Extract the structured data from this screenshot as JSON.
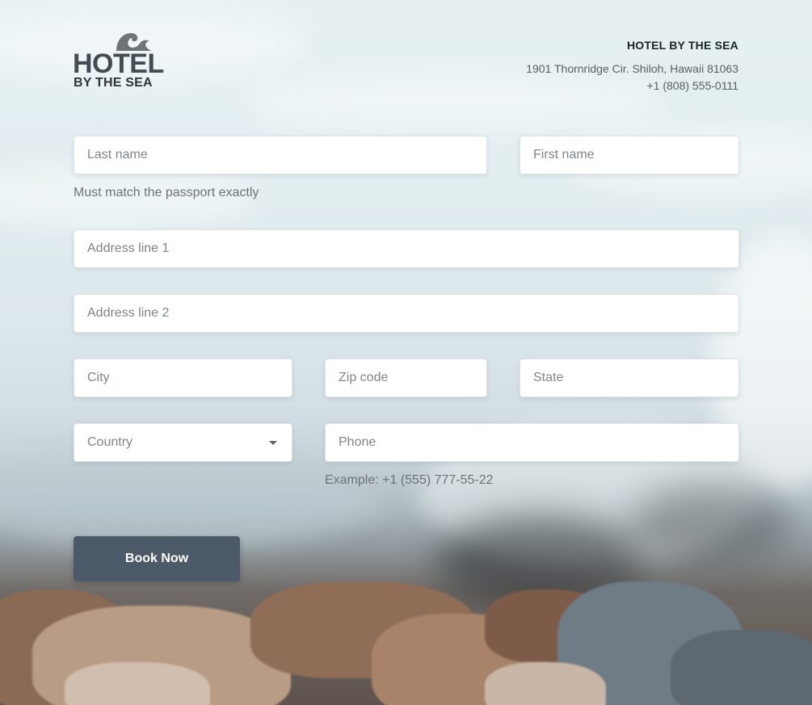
{
  "logo": {
    "line1": "HOTEL",
    "line2": "BY THE SEA"
  },
  "contact": {
    "hotel_name": "HOTEL BY THE SEA",
    "address": "1901 Thornridge Cir. Shiloh, Hawaii 81063",
    "phone": "+1 (808) 555-0111"
  },
  "form": {
    "last_name_placeholder": "Last name",
    "first_name_placeholder": "First name",
    "name_hint": "Must match the passport exactly",
    "address1_placeholder": "Address line 1",
    "address2_placeholder": "Address line 2",
    "city_placeholder": "City",
    "zip_placeholder": "Zip code",
    "state_placeholder": "State",
    "country_label": "Country",
    "phone_placeholder": "Phone",
    "phone_hint": "Example: +1 (555) 777-55-22",
    "submit_label": "Book Now"
  },
  "colors": {
    "button_bg": "#4b5969",
    "logo_text": "#454b52"
  }
}
